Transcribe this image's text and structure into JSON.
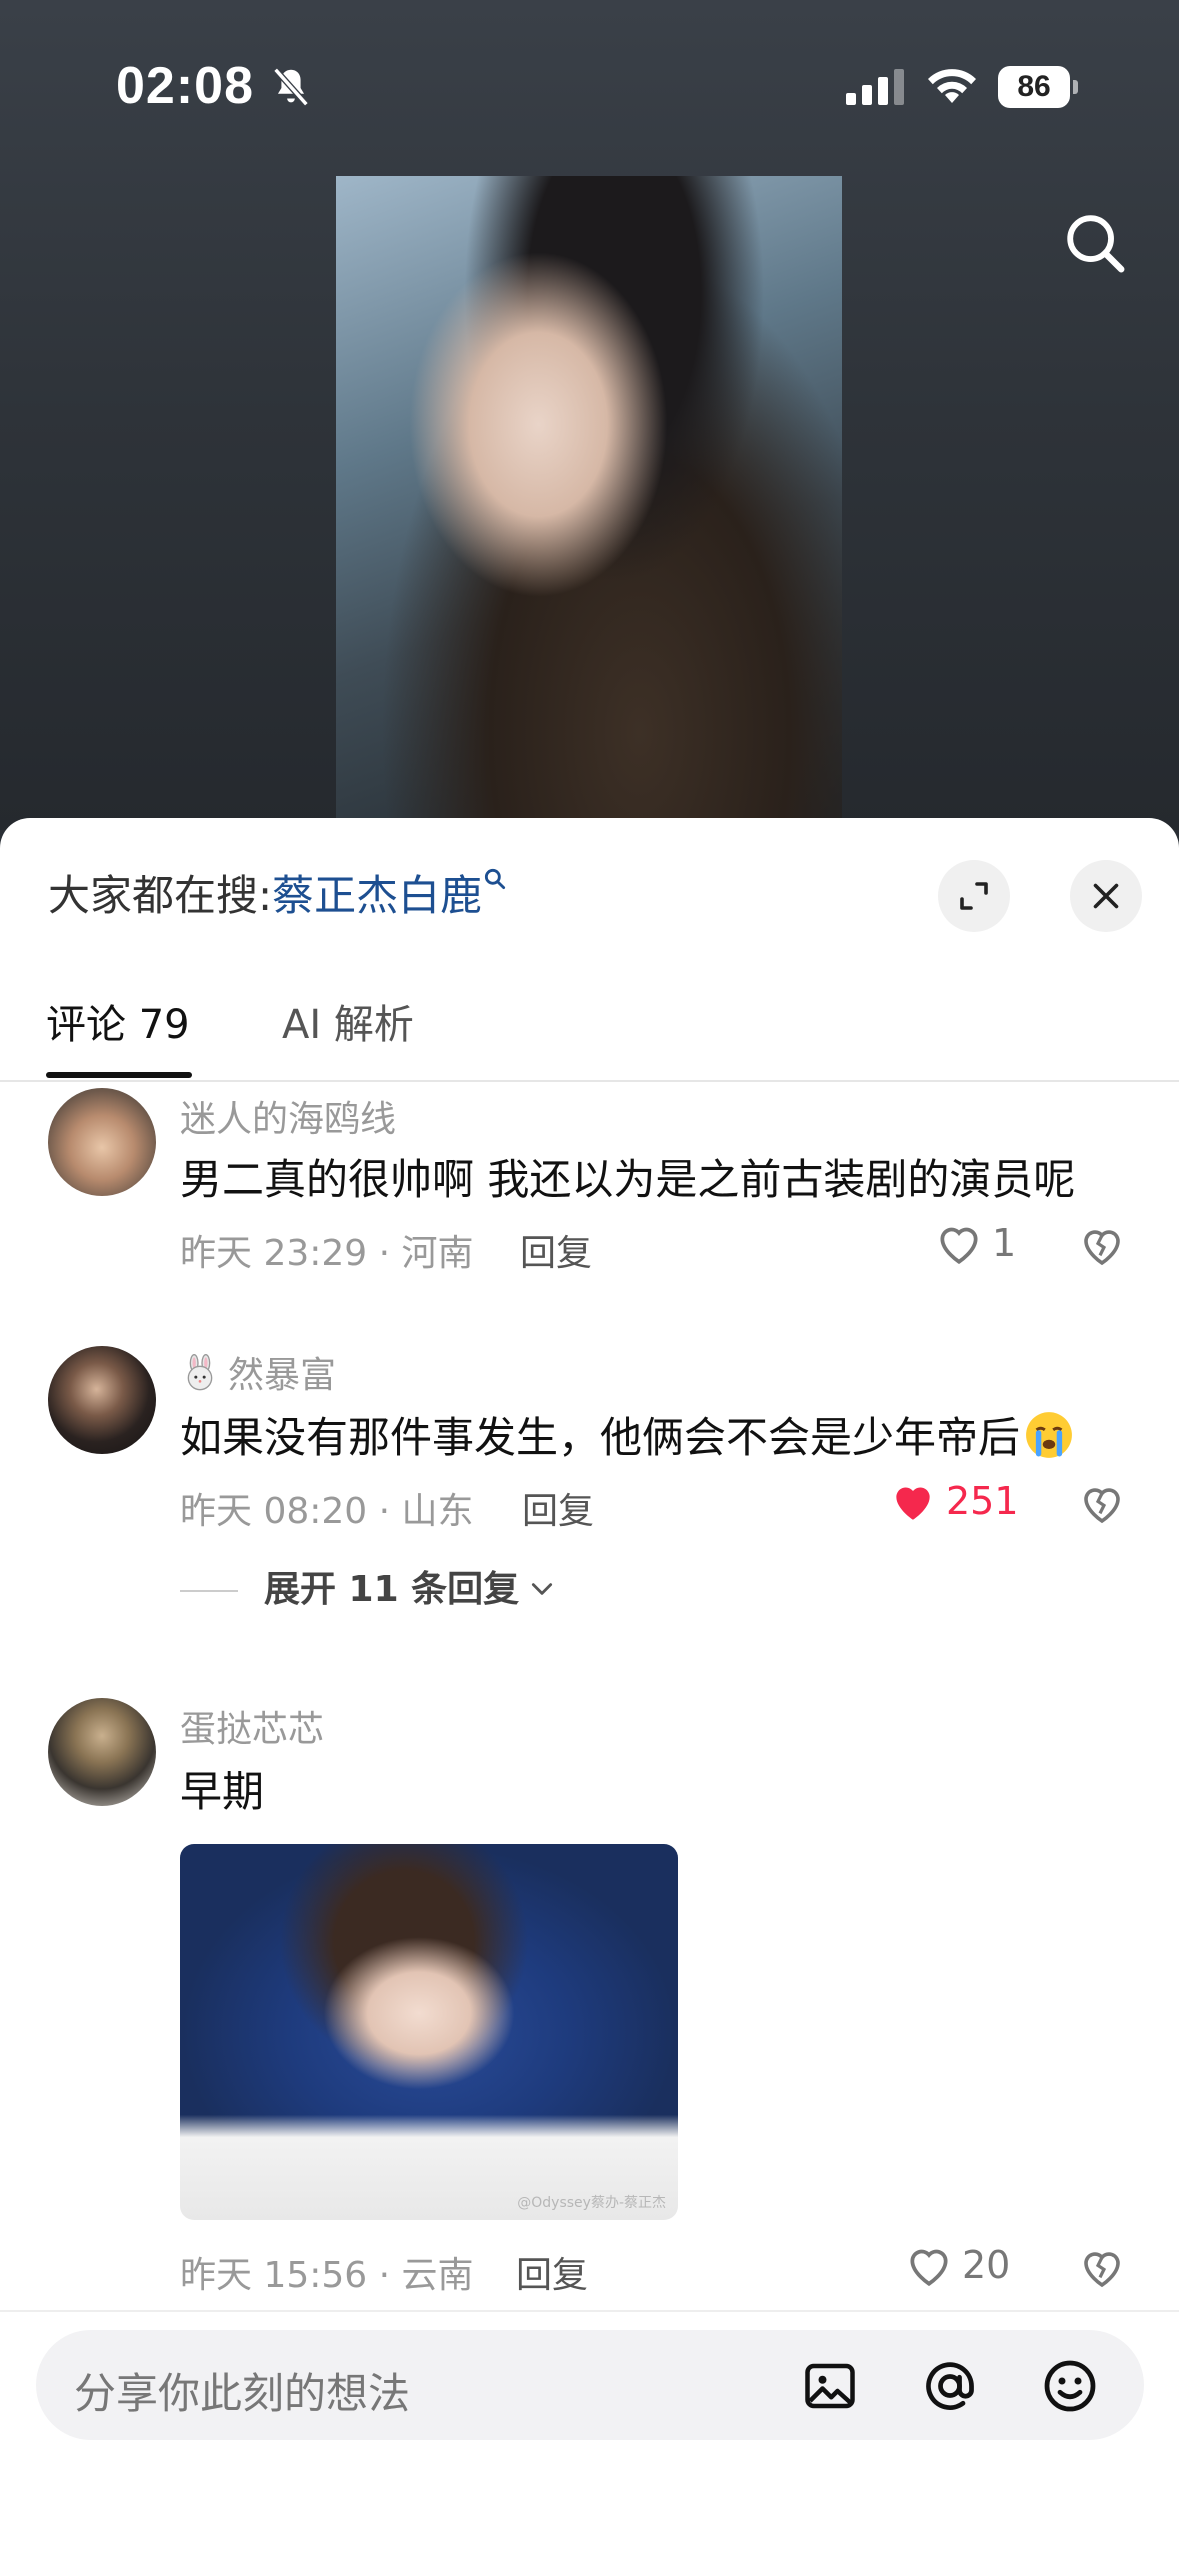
{
  "status_bar": {
    "time": "02:08",
    "battery": "86"
  },
  "hot_search": {
    "prefix": "大家都在搜:",
    "term": "蔡正杰白鹿"
  },
  "tabs": {
    "comments": "评论 79",
    "ai": "AI 解析"
  },
  "comments": [
    {
      "username": "迷人的海鸥线",
      "text": "男二真的很帅啊 我还以为是之前古装剧的演员呢",
      "meta": "昨天 23:29 · 河南",
      "reply": "回复",
      "likes": "1"
    },
    {
      "username": "然暴富",
      "text": "如果没有那件事发生，他俩会不会是少年帝后",
      "meta": "昨天 08:20 · 山东",
      "reply": "回复",
      "likes": "251",
      "expand": "展开 11 条回复"
    },
    {
      "username": "蛋挞芯芯",
      "text": "早期",
      "meta": "昨天 15:56 · 云南",
      "reply": "回复",
      "likes": "20",
      "image_watermark": "@Odyssey蔡办-蔡正杰"
    }
  ],
  "input": {
    "placeholder": "分享你此刻的想法"
  },
  "colors": {
    "link": "#1d4f91",
    "liked": "#f5284d"
  }
}
